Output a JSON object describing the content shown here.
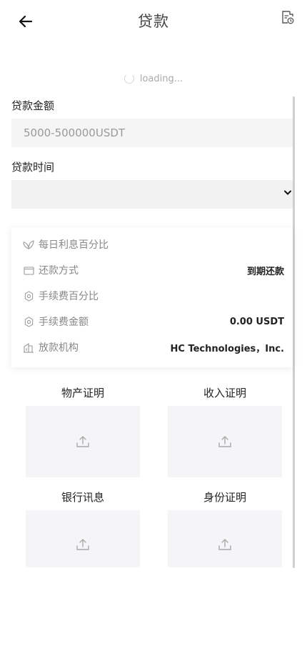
{
  "header": {
    "title": "贷款",
    "back_icon": "arrow-left-icon",
    "record_icon": "record-clock-icon"
  },
  "loading": {
    "text": "loading..."
  },
  "form": {
    "amount_label": "贷款金额",
    "amount_placeholder": "5000-500000USDT",
    "amount_value": "",
    "term_label": "贷款时间",
    "term_selected": ""
  },
  "info": {
    "rows": [
      {
        "icon": "leaf-icon",
        "label": "每日利息百分比",
        "value": ""
      },
      {
        "icon": "wallet-icon",
        "label": "还款方式",
        "value": "到期还款"
      },
      {
        "icon": "gear-icon",
        "label": "手续费百分比",
        "value": ""
      },
      {
        "icon": "gear-icon",
        "label": "手续费金额",
        "value": "0.00 USDT"
      },
      {
        "icon": "building-icon",
        "label": "放款机构",
        "value": "HC Technologies，Inc."
      }
    ]
  },
  "uploads": [
    {
      "label": "物产证明",
      "icon": "upload-icon"
    },
    {
      "label": "收入证明",
      "icon": "upload-icon"
    },
    {
      "label": "银行讯息",
      "icon": "upload-icon"
    },
    {
      "label": "身份证明",
      "icon": "upload-icon"
    }
  ]
}
